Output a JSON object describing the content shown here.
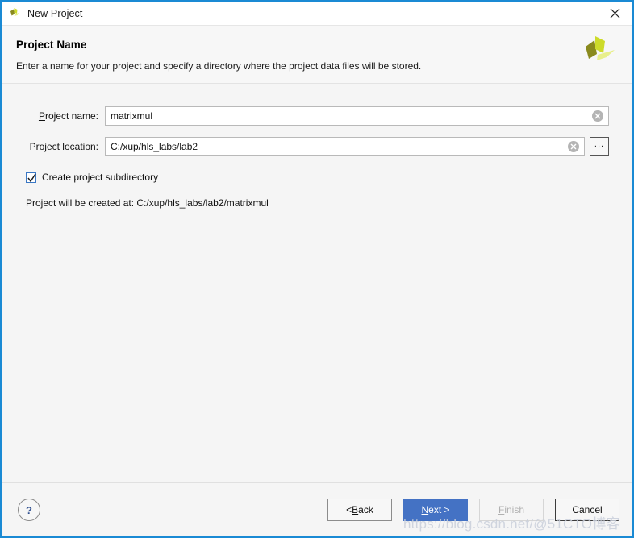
{
  "window": {
    "title": "New Project",
    "title_icon": "vivado-logo-icon",
    "close_icon": "close-icon",
    "border_color": "#1a8ad4"
  },
  "header": {
    "title": "Project Name",
    "subtitle": "Enter a name for your project and specify a directory where the project data files will be stored.",
    "logo_icon": "xilinx-vivado-logo",
    "logo_colors": {
      "dark": "#8a8a1e",
      "bright": "#cddb2a",
      "pale": "#e8ef8c"
    }
  },
  "form": {
    "project_name": {
      "label_pre": "P",
      "label_post": "roject name:",
      "value": "matrixmul",
      "placeholder": "",
      "clear_icon": "clear-circle-icon"
    },
    "project_location": {
      "label_pre": "Project ",
      "label_mn": "l",
      "label_post": "ocation:",
      "value": "C:/xup/hls_labs/lab2",
      "placeholder": "",
      "clear_icon": "clear-circle-icon",
      "browse_label": "...",
      "browse_icon": "browse-ellipsis-icon"
    },
    "create_subdirectory": {
      "label": "Create project subdirectory",
      "checked": true,
      "check_icon": "checkmark-icon",
      "accent": "#3a77c4"
    },
    "created_at_text": "Project will be created at: C:/xup/hls_labs/lab2/matrixmul"
  },
  "footer": {
    "help_label": "?",
    "help_icon": "question-mark-icon",
    "buttons": [
      {
        "id": "back",
        "label_pre": "< ",
        "label_mn": "B",
        "label_post": "ack",
        "state": "enabled"
      },
      {
        "id": "next",
        "label_pre": "",
        "label_mn": "N",
        "label_post": "ext >",
        "state": "primary"
      },
      {
        "id": "finish",
        "label_pre": "",
        "label_mn": "F",
        "label_post": "inish",
        "state": "disabled"
      },
      {
        "id": "cancel",
        "label_pre": "",
        "label_mn": "",
        "label_post": "Cancel",
        "state": "enabled"
      }
    ],
    "primary_color": "#4472c4"
  },
  "watermark": {
    "text": "https://blog.csdn.net/@51CTO博客"
  }
}
